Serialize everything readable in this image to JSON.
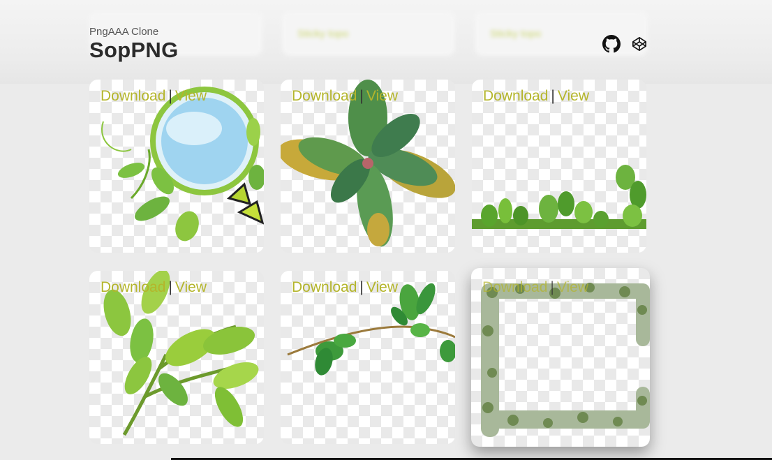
{
  "header": {
    "subtitle": "PngAAA Clone",
    "title": "SopPNG",
    "icons": [
      "github-icon",
      "codepen-icon"
    ]
  },
  "ghost_cards": [
    {
      "label": ""
    },
    {
      "label": "Sticky topo"
    },
    {
      "label": "Sticky topo"
    }
  ],
  "cards": [
    {
      "download": "Download",
      "separator": "|",
      "view": "View",
      "image": "green-circle-frame-with-leaves-and-butterfly"
    },
    {
      "download": "Download",
      "separator": "|",
      "view": "View",
      "image": "plant-top-view"
    },
    {
      "download": "Download",
      "separator": "|",
      "view": "View",
      "image": "green-leaves-border"
    },
    {
      "download": "Download",
      "separator": "|",
      "view": "View",
      "image": "green-leafy-branch"
    },
    {
      "download": "Download",
      "separator": "|",
      "view": "View",
      "image": "ivy-vine"
    },
    {
      "download": "Download",
      "separator": "|",
      "view": "View",
      "image": "leaf-square-frame"
    }
  ],
  "colors": {
    "link": "#b4b52b",
    "background": "#ebebeb",
    "leaf": "#7cc142"
  }
}
